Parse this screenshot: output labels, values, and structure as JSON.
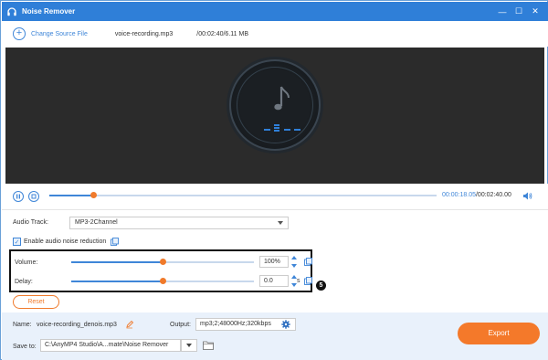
{
  "app": {
    "title": "Noise Remover"
  },
  "window_controls": {
    "minimize": "—",
    "maximize": "☐",
    "close": "✕"
  },
  "filebar": {
    "change_source_label": "Change Source File",
    "file_name": "voice-recording.mp3",
    "file_meta": "/00:02:40/6.11 MB"
  },
  "playback": {
    "current_time": "00:00:18.05",
    "total_time": "/00:02:40.00",
    "progress_fraction": 0.113
  },
  "settings": {
    "audio_track_label": "Audio Track:",
    "audio_track_value": "MP3-2Channel",
    "enable_noise_label": "Enable audio noise reduction",
    "enable_noise_checked": true,
    "volume": {
      "label": "Volume:",
      "value": "100%",
      "fraction": 0.5
    },
    "delay": {
      "label": "Delay:",
      "value": "0.0",
      "unit": "s",
      "fraction": 0.5
    },
    "step_badge": "5",
    "reset_label": "Reset"
  },
  "output": {
    "name_label": "Name:",
    "name_value": "voice-recording_denois.mp3",
    "output_label": "Output:",
    "output_value": "mp3;2;48000Hz;320kbps",
    "save_to_label": "Save to:",
    "save_to_value": "C:\\AnyMP4 Studio\\A...mate\\Noise Remover",
    "export_label": "Export"
  },
  "colors": {
    "accent": "#2f7fd8",
    "orange": "#f4792a"
  }
}
